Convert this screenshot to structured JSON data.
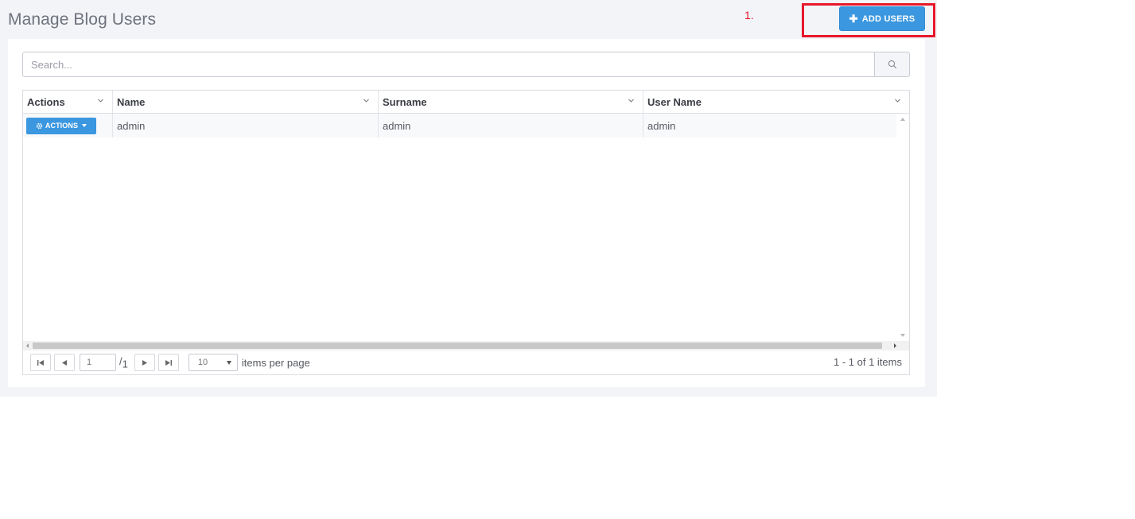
{
  "page": {
    "title": "Manage Blog Users",
    "annotation_number": "1.",
    "add_button_label": "ADD USERS"
  },
  "search": {
    "placeholder": "Search...",
    "value": ""
  },
  "grid": {
    "columns": [
      "Actions",
      "Name",
      "Surname",
      "User Name"
    ],
    "rows": [
      {
        "actions_label": "ACTIONS",
        "name": "admin",
        "surname": "admin",
        "username": "admin"
      }
    ]
  },
  "pager": {
    "current_page": "1",
    "page_separator": "/",
    "total_pages": "1",
    "page_size": "10",
    "items_per_page_label": "items per page",
    "info": "1 - 1 of 1 items"
  },
  "colors": {
    "primary": "#3b97df",
    "annotation": "#e8172b",
    "background": "#f3f4f8"
  },
  "icons": {
    "add": "plus-icon",
    "search": "search-icon",
    "actions": "gear-icon",
    "sort": "chevron-down-icon"
  }
}
